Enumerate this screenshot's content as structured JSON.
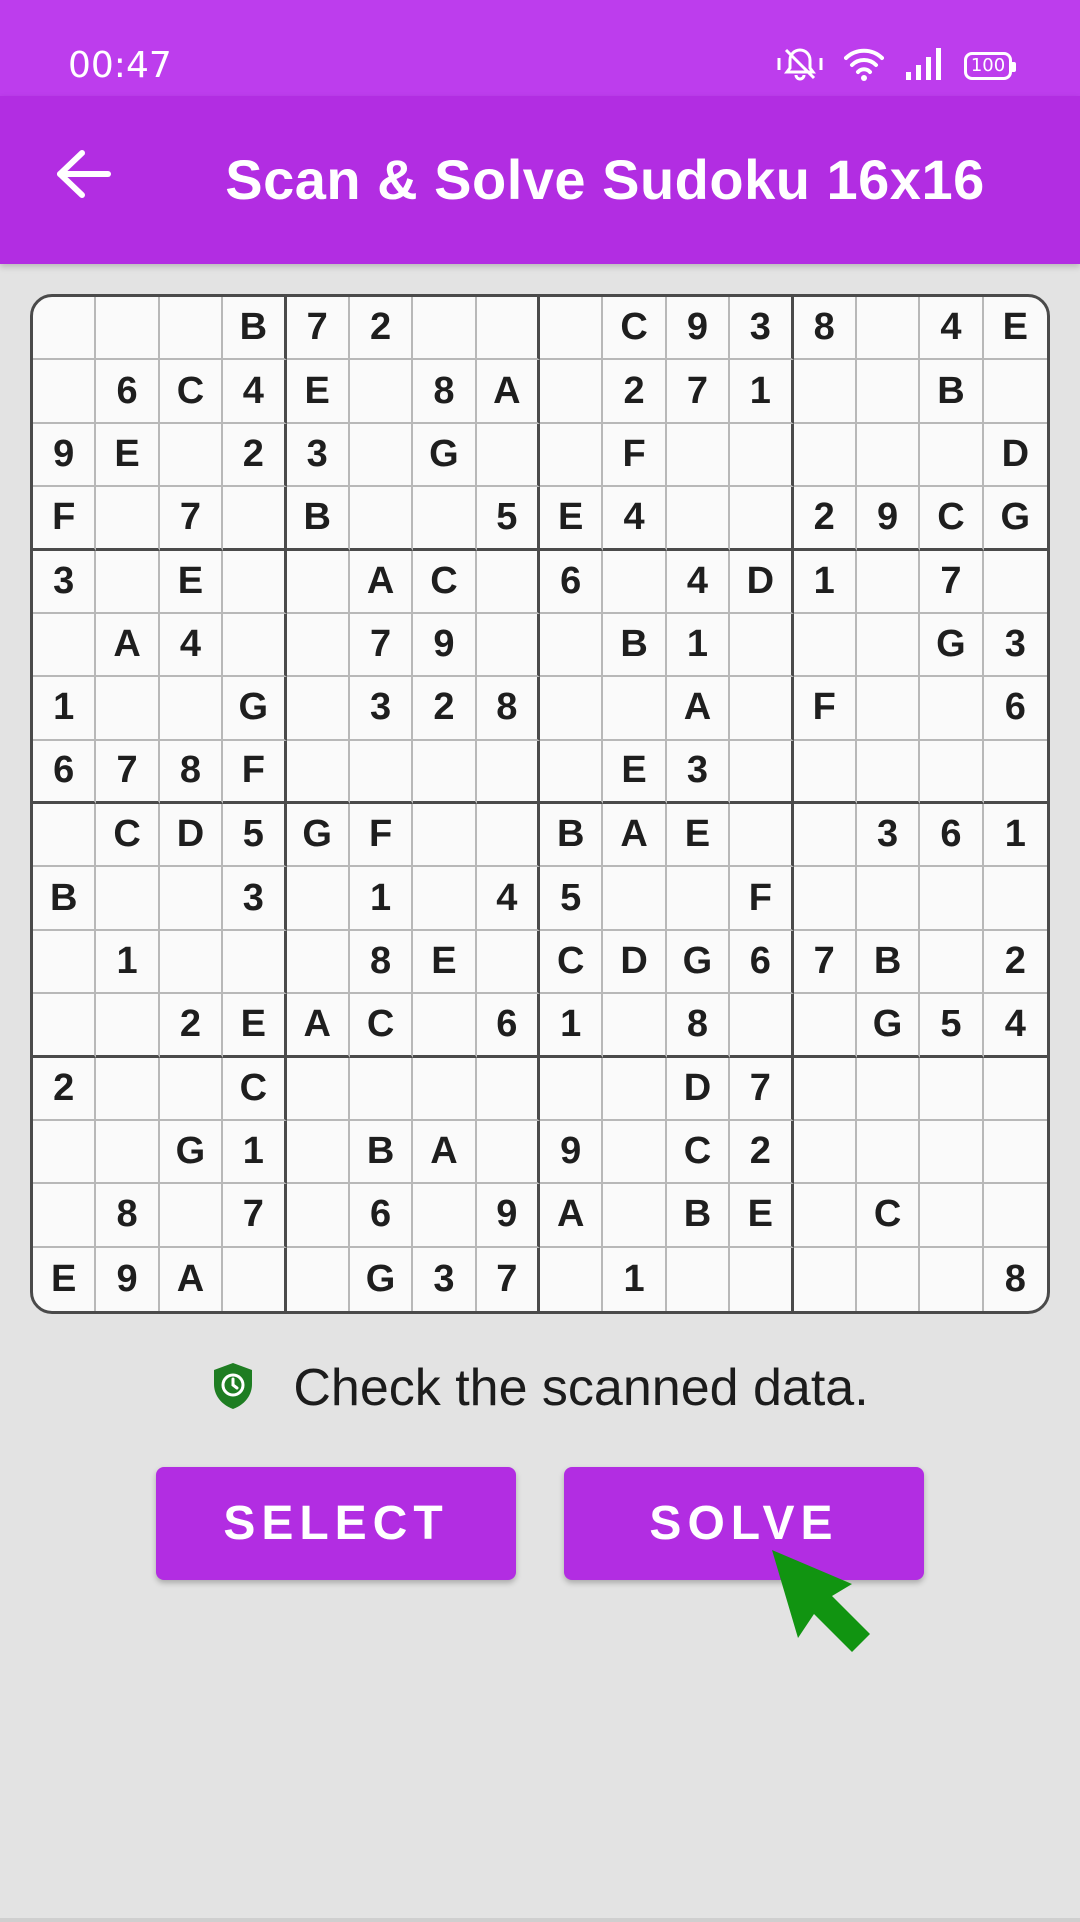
{
  "status_bar": {
    "time": "00:47",
    "battery": "100"
  },
  "app_bar": {
    "title": "Scan & Solve Sudoku 16x16"
  },
  "grid": [
    [
      "",
      "",
      "",
      "B",
      "7",
      "2",
      "",
      "",
      "",
      "C",
      "9",
      "3",
      "8",
      "",
      "4",
      "E"
    ],
    [
      "",
      "6",
      "C",
      "4",
      "E",
      "",
      "8",
      "A",
      "",
      "2",
      "7",
      "1",
      "",
      "",
      "B",
      ""
    ],
    [
      "9",
      "E",
      "",
      "2",
      "3",
      "",
      "G",
      "",
      "",
      "F",
      "",
      "",
      "",
      "",
      "",
      "D"
    ],
    [
      "F",
      "",
      "7",
      "",
      "B",
      "",
      "",
      "5",
      "E",
      "4",
      "",
      "",
      "2",
      "9",
      "C",
      "G"
    ],
    [
      "3",
      "",
      "E",
      "",
      "",
      "A",
      "C",
      "",
      "6",
      "",
      "4",
      "D",
      "1",
      "",
      "7",
      ""
    ],
    [
      "",
      "A",
      "4",
      "",
      "",
      "7",
      "9",
      "",
      "",
      "B",
      "1",
      "",
      "",
      "",
      "G",
      "3"
    ],
    [
      "1",
      "",
      "",
      "G",
      "",
      "3",
      "2",
      "8",
      "",
      "",
      "A",
      "",
      "F",
      "",
      "",
      "6"
    ],
    [
      "6",
      "7",
      "8",
      "F",
      "",
      "",
      "",
      "",
      "",
      "E",
      "3",
      "",
      "",
      "",
      "",
      ""
    ],
    [
      "",
      "C",
      "D",
      "5",
      "G",
      "F",
      "",
      "",
      "B",
      "A",
      "E",
      "",
      "",
      "3",
      "6",
      "1"
    ],
    [
      "B",
      "",
      "",
      "3",
      "",
      "1",
      "",
      "4",
      "5",
      "",
      "",
      "F",
      "",
      "",
      "",
      ""
    ],
    [
      "",
      "1",
      "",
      "",
      "",
      "8",
      "E",
      "",
      "C",
      "D",
      "G",
      "6",
      "7",
      "B",
      "",
      "2"
    ],
    [
      "",
      "",
      "2",
      "E",
      "A",
      "C",
      "",
      "6",
      "1",
      "",
      "8",
      "",
      "",
      "G",
      "5",
      "4"
    ],
    [
      "2",
      "",
      "",
      "C",
      "",
      "",
      "",
      "",
      "",
      "",
      "D",
      "7",
      "",
      "",
      "",
      ""
    ],
    [
      "",
      "",
      "G",
      "1",
      "",
      "B",
      "A",
      "",
      "9",
      "",
      "C",
      "2",
      "",
      "",
      "",
      ""
    ],
    [
      "",
      "8",
      "",
      "7",
      "",
      "6",
      "",
      "9",
      "A",
      "",
      "B",
      "E",
      "",
      "C",
      "",
      ""
    ],
    [
      "E",
      "9",
      "A",
      "",
      "",
      "G",
      "3",
      "7",
      "",
      "1",
      "",
      "",
      "",
      "",
      "",
      "8"
    ]
  ],
  "hint": {
    "text": "Check the scanned data.",
    "icon": "shield-clock-icon",
    "icon_color": "#1e7d22"
  },
  "buttons": {
    "select_label": "SELECT",
    "solve_label": "SOLVE"
  },
  "colors": {
    "status_bar": "#bd3ded",
    "app_bar": "#b22de2",
    "button": "#b22de2",
    "cursor": "#119411"
  }
}
